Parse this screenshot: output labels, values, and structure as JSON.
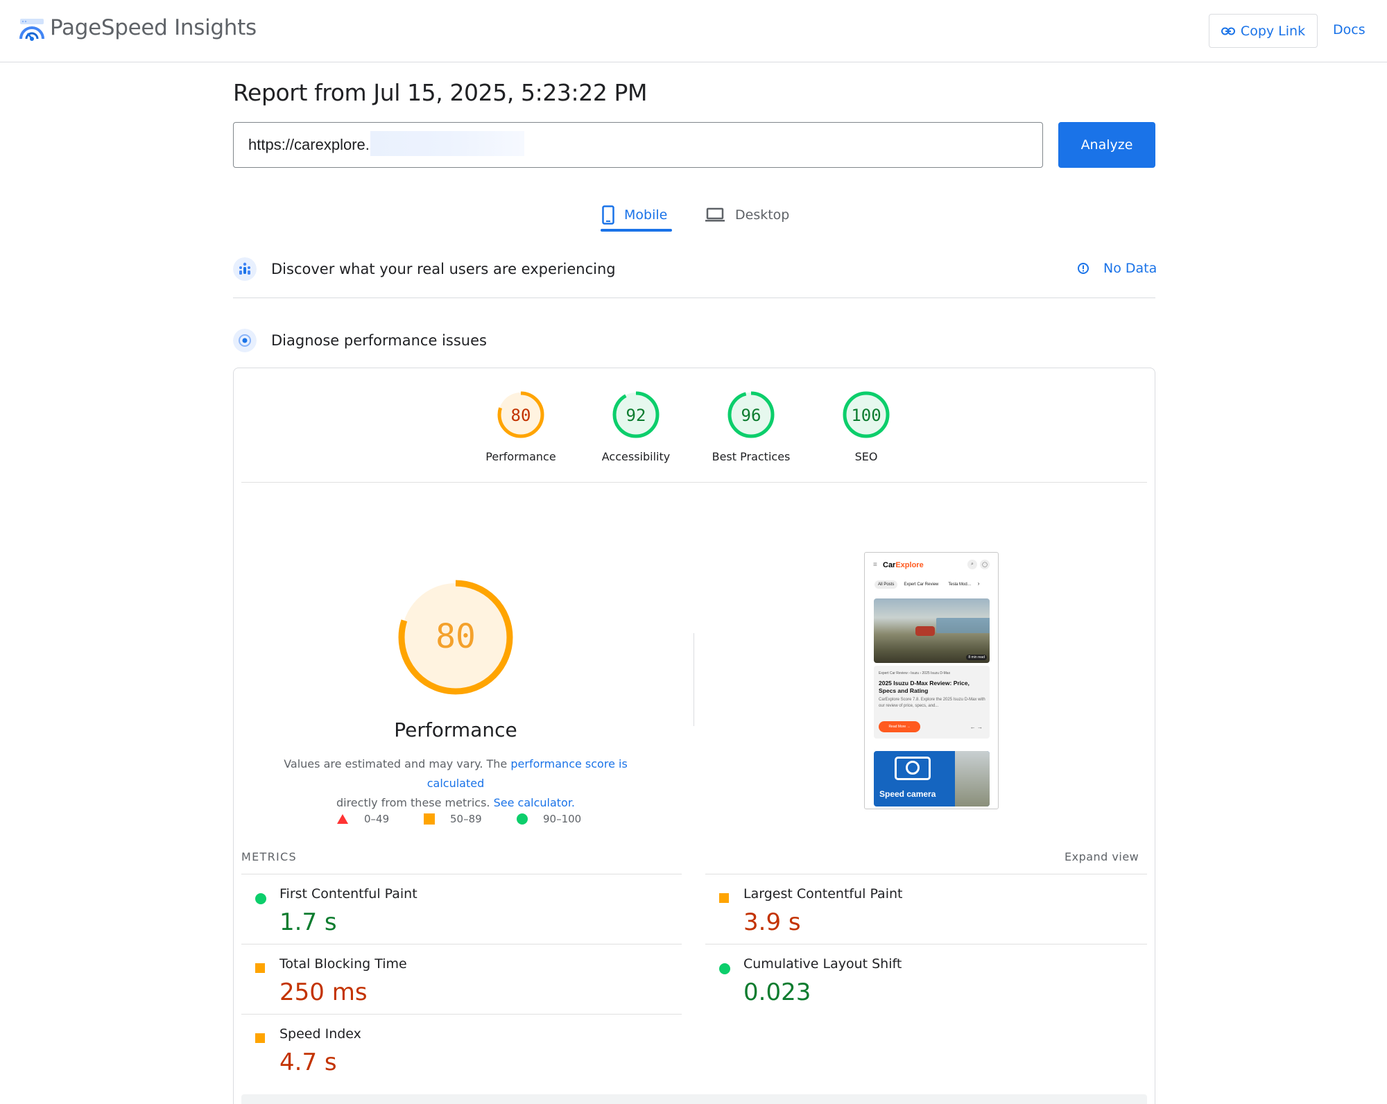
{
  "header": {
    "app_title": "PageSpeed Insights",
    "copy_link_label": "Copy Link",
    "docs_label": "Docs"
  },
  "report": {
    "title": "Report from Jul 15, 2025, 5:23:22 PM",
    "url_value": "https://carexplore.",
    "analyze_label": "Analyze"
  },
  "tabs": {
    "mobile_label": "Mobile",
    "desktop_label": "Desktop",
    "active": "mobile"
  },
  "sections": {
    "real_users_title": "Discover what your real users are experiencing",
    "no_data_label": "No Data",
    "diagnose_title": "Diagnose performance issues"
  },
  "scores": [
    {
      "label": "Performance",
      "value": "80",
      "score": 80,
      "color": "#ffa400",
      "bg": "#fff3e0",
      "text": "#c33300"
    },
    {
      "label": "Accessibility",
      "value": "92",
      "score": 92,
      "color": "#0cce6b",
      "bg": "#e6f8ee",
      "text": "#0d7c2f"
    },
    {
      "label": "Best Practices",
      "value": "96",
      "score": 96,
      "color": "#0cce6b",
      "bg": "#e6f8ee",
      "text": "#0d7c2f"
    },
    {
      "label": "SEO",
      "value": "100",
      "score": 100,
      "color": "#0cce6b",
      "bg": "#e6f8ee",
      "text": "#0d7c2f"
    }
  ],
  "performance": {
    "score": "80",
    "score_num": 80,
    "title": "Performance",
    "desc_prefix": "Values are estimated and may vary. The ",
    "desc_link1": "performance score is calculated",
    "desc_middle": "directly from these metrics. ",
    "desc_link2": "See calculator.",
    "legend": {
      "red": "0–49",
      "orange": "50–89",
      "green": "90–100"
    }
  },
  "screenshot": {
    "brand_car": "Car",
    "brand_explore": "Explore",
    "chips": [
      "All Posts",
      "Expert Car Review",
      "Tesla Mod…"
    ],
    "hero_tag": "8 min read",
    "crumbs": "Expert Car Review  ›  Isuzu  ›  2025 Isuzu D-Max",
    "article_title": "2025 Isuzu D-Max Review: Price, Specs and Rating",
    "article_desc": "CarExplore Score 7.8. Explore the 2025 Isuzu D-Max with our review of price, specs, and...",
    "read_more": "Read More →",
    "arrows": "←  →",
    "card2_text": "Speed camera"
  },
  "metrics": {
    "heading": "METRICS",
    "expand_label": "Expand view",
    "items": [
      {
        "name": "First Contentful Paint",
        "value": "1.7 s",
        "status": "good"
      },
      {
        "name": "Largest Contentful Paint",
        "value": "3.9 s",
        "status": "average"
      },
      {
        "name": "Total Blocking Time",
        "value": "250 ms",
        "status": "average"
      },
      {
        "name": "Cumulative Layout Shift",
        "value": "0.023",
        "status": "good"
      },
      {
        "name": "Speed Index",
        "value": "4.7 s",
        "status": "average"
      }
    ]
  }
}
